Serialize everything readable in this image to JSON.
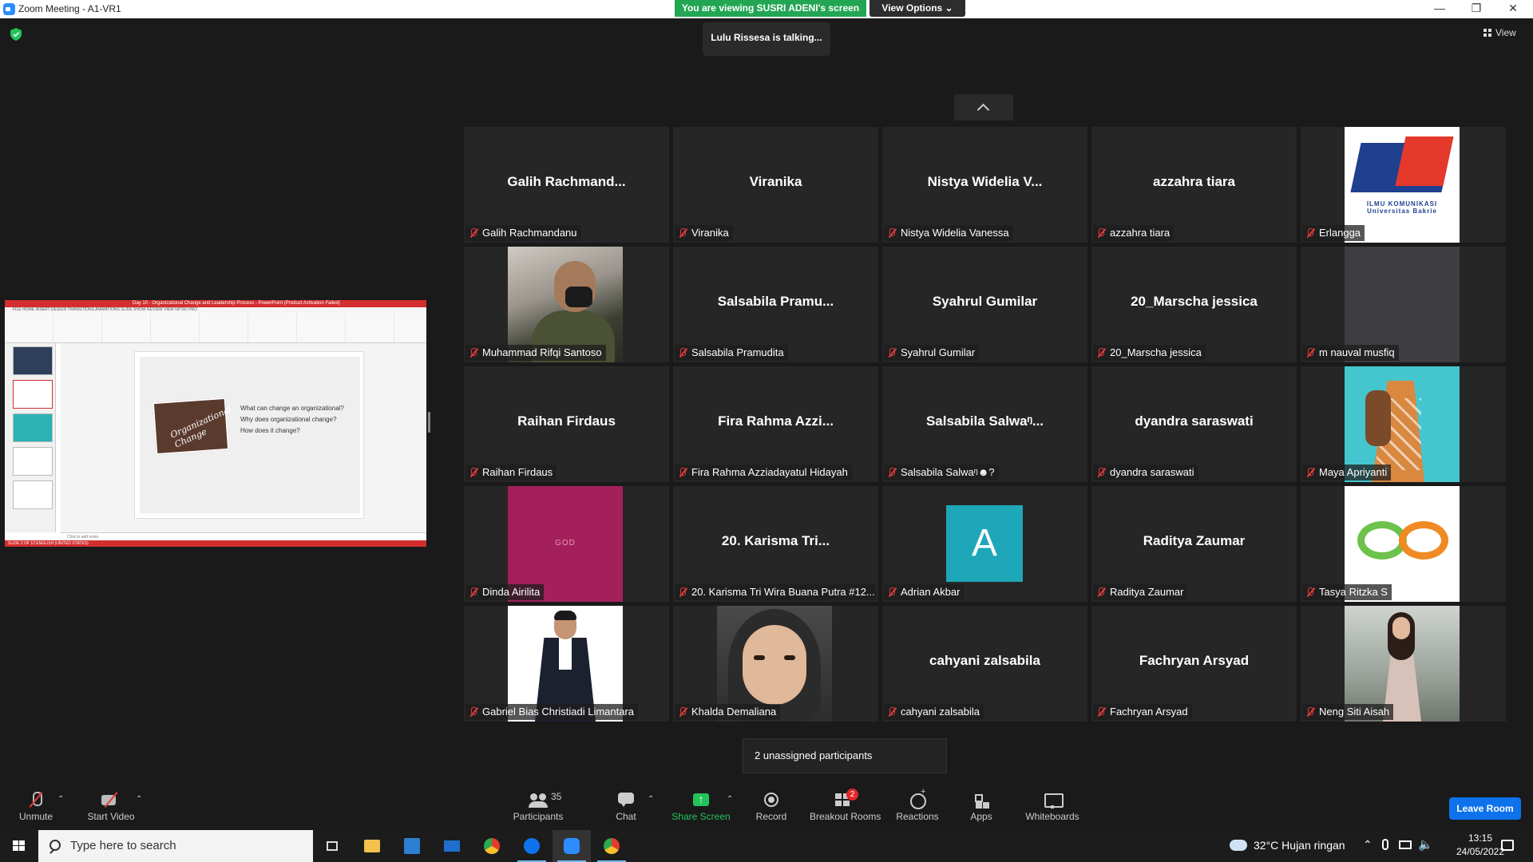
{
  "window": {
    "title": "Zoom Meeting - A1-VR1",
    "minimize": "—",
    "maximize": "❐",
    "close": "✕"
  },
  "banner": {
    "viewing": "You are viewing SUSRI ADENI's screen",
    "view_options": "View Options ⌄"
  },
  "talking": "Lulu Rissesa is talking...",
  "view_button": "View",
  "shared_screen": {
    "ppt_title": "Day 10 - Organizational Change and Leadership Process - PowerPoint (Product Activation Failed)",
    "ppt_tabs": "FILE    HOME    INSERT    DESIGN    TRANSITIONS    ANIMATIONS    SLIDE SHOW    REVIEW    VIEW    NITRO PRO",
    "slide_image_text": "Organizational Change",
    "slide_lines": [
      "What can change an organizational?",
      "Why does organizational change?",
      "How does it change?"
    ],
    "notes": "Click to add notes",
    "status": "SLIDE 2 OF 12    ENGLISH (UNITED STATES)"
  },
  "participants": [
    {
      "big": "Galih  Rachmand...",
      "name": "Galih Rachmandanu"
    },
    {
      "big": "Viranika",
      "name": "Viranika"
    },
    {
      "big": "Nistya  Widelia  V...",
      "name": "Nistya Widelia Vanessa"
    },
    {
      "big": "azzahra  tiara",
      "name": "azzahra tiara"
    },
    {
      "big": "",
      "name": "Erlangga",
      "logo_text": "ILMU KOMUNIKASI\nUniversitas Bakrie"
    },
    {
      "big": "",
      "name": "Muhammad Rifqi Santoso"
    },
    {
      "big": "Salsabila  Pramu...",
      "name": "Salsabila Pramudita"
    },
    {
      "big": "Syahrul  Gumilar",
      "name": "Syahrul Gumilar"
    },
    {
      "big": "20_Marscha  jessica",
      "name": "20_Marscha jessica"
    },
    {
      "big": "",
      "name": "m nauval musfiq"
    },
    {
      "big": "Raihan  Firdaus",
      "name": "Raihan Firdaus"
    },
    {
      "big": "Fira  Rahma  Azzi...",
      "name": "Fira Rahma Azziadayatul Hidayah"
    },
    {
      "big": "Salsabila  Salwaᵑ...",
      "name": "Salsabila Salwaᵑ☻?"
    },
    {
      "big": "dyandra  saraswati",
      "name": "dyandra saraswati"
    },
    {
      "big": "",
      "name": "Maya Apriyanti"
    },
    {
      "big": "",
      "name": "Dinda Airilita",
      "pic_text": "GOD"
    },
    {
      "big": "20.  Karisma  Tri...",
      "name": "20. Karisma Tri Wira Buana Putra #12..."
    },
    {
      "big": "",
      "name": "Adrian Akbar",
      "avatar_letter": "A"
    },
    {
      "big": "Raditya  Zaumar",
      "name": "Raditya Zaumar"
    },
    {
      "big": "",
      "name": "Tasya Ritzka S"
    },
    {
      "big": "",
      "name": "Gabriel Bias Christiadi Limantara"
    },
    {
      "big": "",
      "name": "Khalda Demaliana"
    },
    {
      "big": "cahyani  zalsabila",
      "name": "cahyani zalsabila"
    },
    {
      "big": "Fachryan  Arsyad",
      "name": "Fachryan Arsyad"
    },
    {
      "big": "",
      "name": "Neng Siti Aisah"
    }
  ],
  "unassigned": "2 unassigned participants",
  "toolbar": {
    "unmute": "Unmute",
    "start_video": "Start Video",
    "participants": "Participants",
    "participants_count": "35",
    "chat": "Chat",
    "share_screen": "Share Screen",
    "record": "Record",
    "breakout_rooms": "Breakout Rooms",
    "breakout_badge": "2",
    "reactions": "Reactions",
    "apps": "Apps",
    "whiteboards": "Whiteboards",
    "leave_room": "Leave Room"
  },
  "taskbar": {
    "search_placeholder": "Type here to search",
    "weather": "32°C  Hujan ringan",
    "time": "13:15",
    "date": "24/05/2022"
  },
  "colors": {
    "banner_green": "#23a654",
    "share_green": "#23c35c",
    "leave_blue": "#0e72ed",
    "muted_red": "#e23b3b"
  }
}
